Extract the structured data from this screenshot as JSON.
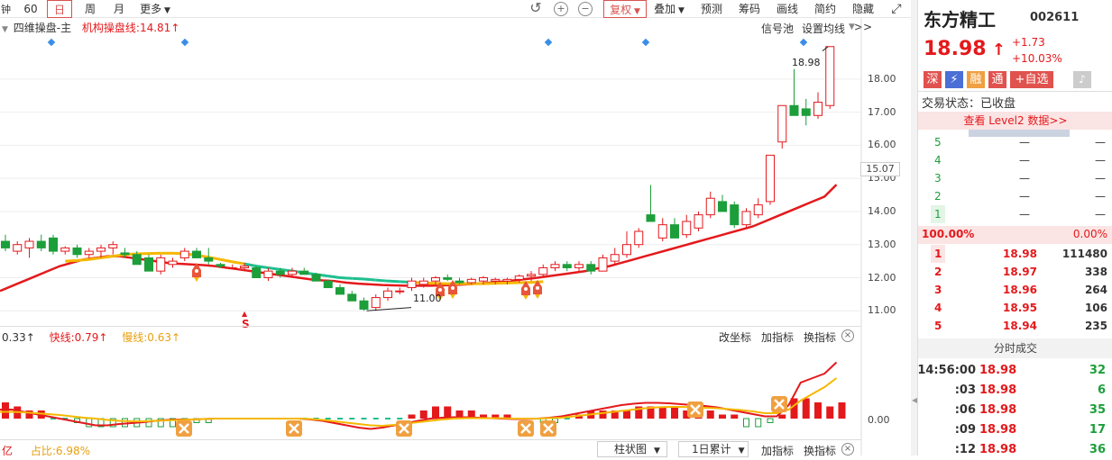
{
  "toolbar": {
    "periods": [
      "60",
      "日",
      "周",
      "月",
      "更多"
    ],
    "active_period": "日",
    "buttons": [
      "复权",
      "叠加",
      "预测",
      "筹码",
      "画线",
      "简约",
      "隐藏>>"
    ]
  },
  "main_indicator": {
    "name": "四维操盘-主",
    "line_label": "机构操盘线:14.81",
    "right_labels": [
      "信号池",
      "设置均线"
    ],
    "price_axis": [
      "18.00",
      "17.00",
      "16.00",
      "15.00",
      "14.00",
      "13.00",
      "12.00",
      "11.00"
    ],
    "current_marker": "15.07",
    "high_label": "18.98",
    "low_label": "11.00",
    "signal_letter": "S"
  },
  "sub_indicator": {
    "value_prefix": "0.33",
    "fast_label": "快线:0.79",
    "slow_label": "慢线:0.63",
    "right_buttons": [
      "改坐标",
      "加指标",
      "换指标"
    ],
    "zero_label": "0.00"
  },
  "bottom_bar": {
    "left_prefix": "亿",
    "ratio_label": "占比:6.98%",
    "chart_type": "柱状图",
    "accumulate": "1日累计",
    "buttons": [
      "加指标",
      "换指标"
    ]
  },
  "stock": {
    "name": "东方精工",
    "code": "002611",
    "price": "18.98",
    "change": "+1.73",
    "change_pct": "+10.03%",
    "tags": [
      "深",
      "融",
      "通",
      "+自选"
    ],
    "status_label": "交易状态：",
    "status_value": "已收盘",
    "level2_link": "查看 Level2 数据>>"
  },
  "order_book": {
    "sell": [
      {
        "level": "5",
        "price": "—",
        "vol": "—"
      },
      {
        "level": "4",
        "price": "—",
        "vol": "—"
      },
      {
        "level": "3",
        "price": "—",
        "vol": "—"
      },
      {
        "level": "2",
        "price": "—",
        "vol": "—"
      },
      {
        "level": "1",
        "price": "—",
        "vol": "—"
      }
    ],
    "ratio_left": "100.00%",
    "ratio_right": "0.00%",
    "buy": [
      {
        "level": "1",
        "price": "18.98",
        "vol": "111480"
      },
      {
        "level": "2",
        "price": "18.97",
        "vol": "338"
      },
      {
        "level": "3",
        "price": "18.96",
        "vol": "264"
      },
      {
        "level": "4",
        "price": "18.95",
        "vol": "106"
      },
      {
        "level": "5",
        "price": "18.94",
        "vol": "235"
      }
    ]
  },
  "trades": {
    "title": "分时成交",
    "rows": [
      {
        "time": "14:56:00",
        "price": "18.98",
        "vol": "32"
      },
      {
        "time": ":03",
        "price": "18.98",
        "vol": "6"
      },
      {
        "time": ":06",
        "price": "18.98",
        "vol": "35"
      },
      {
        "time": ":09",
        "price": "18.98",
        "vol": "17"
      },
      {
        "time": ":12",
        "price": "18.98",
        "vol": "36"
      }
    ]
  },
  "chart_data": {
    "type": "candlestick",
    "ylim": [
      10.6,
      19.3
    ],
    "candles": [
      {
        "o": 13.1,
        "h": 13.3,
        "l": 12.8,
        "c": 12.9
      },
      {
        "o": 12.8,
        "h": 13.1,
        "l": 12.7,
        "c": 13.0
      },
      {
        "o": 12.9,
        "h": 13.2,
        "l": 12.6,
        "c": 13.1
      },
      {
        "o": 13.1,
        "h": 13.3,
        "l": 12.8,
        "c": 12.9
      },
      {
        "o": 13.2,
        "h": 13.3,
        "l": 12.7,
        "c": 12.8
      },
      {
        "o": 12.8,
        "h": 12.95,
        "l": 12.7,
        "c": 12.9
      },
      {
        "o": 12.9,
        "h": 13.0,
        "l": 12.6,
        "c": 12.7
      },
      {
        "o": 12.7,
        "h": 12.9,
        "l": 12.6,
        "c": 12.8
      },
      {
        "o": 12.8,
        "h": 13.0,
        "l": 12.6,
        "c": 12.9
      },
      {
        "o": 12.9,
        "h": 13.1,
        "l": 12.7,
        "c": 13.0
      },
      {
        "o": 12.75,
        "h": 12.9,
        "l": 12.6,
        "c": 12.7
      },
      {
        "o": 12.7,
        "h": 12.8,
        "l": 12.4,
        "c": 12.4
      },
      {
        "o": 12.6,
        "h": 12.7,
        "l": 12.2,
        "c": 12.2
      },
      {
        "o": 12.2,
        "h": 12.7,
        "l": 12.1,
        "c": 12.6
      },
      {
        "o": 12.4,
        "h": 12.6,
        "l": 12.3,
        "c": 12.5
      },
      {
        "o": 12.6,
        "h": 12.9,
        "l": 12.5,
        "c": 12.8
      },
      {
        "o": 12.8,
        "h": 12.9,
        "l": 12.6,
        "c": 12.6
      },
      {
        "o": 12.6,
        "h": 12.9,
        "l": 12.4,
        "c": 12.5
      },
      {
        "o": 12.4,
        "h": 12.45,
        "l": 12.3,
        "c": 12.35
      },
      {
        "o": 12.3,
        "h": 12.4,
        "l": 12.3,
        "c": 12.3
      },
      {
        "o": 12.3,
        "h": 12.45,
        "l": 12.25,
        "c": 12.35
      },
      {
        "o": 12.3,
        "h": 12.35,
        "l": 12.0,
        "c": 12.0
      },
      {
        "o": 12.0,
        "h": 12.3,
        "l": 11.9,
        "c": 12.2
      },
      {
        "o": 12.2,
        "h": 12.3,
        "l": 12.0,
        "c": 12.1
      },
      {
        "o": 12.1,
        "h": 12.3,
        "l": 12.0,
        "c": 12.2
      },
      {
        "o": 12.2,
        "h": 12.3,
        "l": 12.1,
        "c": 12.1
      },
      {
        "o": 12.1,
        "h": 12.15,
        "l": 11.9,
        "c": 11.9
      },
      {
        "o": 11.9,
        "h": 11.95,
        "l": 11.7,
        "c": 11.7
      },
      {
        "o": 11.7,
        "h": 11.8,
        "l": 11.5,
        "c": 11.5
      },
      {
        "o": 11.5,
        "h": 11.6,
        "l": 11.3,
        "c": 11.3
      },
      {
        "o": 11.3,
        "h": 11.4,
        "l": 11.0,
        "c": 11.05
      },
      {
        "o": 11.1,
        "h": 11.5,
        "l": 11.0,
        "c": 11.4
      },
      {
        "o": 11.4,
        "h": 11.7,
        "l": 11.3,
        "c": 11.6
      },
      {
        "o": 11.6,
        "h": 11.7,
        "l": 11.5,
        "c": 11.6
      },
      {
        "o": 11.7,
        "h": 12.0,
        "l": 11.6,
        "c": 11.9
      },
      {
        "o": 11.8,
        "h": 12.0,
        "l": 11.7,
        "c": 11.9
      },
      {
        "o": 11.9,
        "h": 12.05,
        "l": 11.8,
        "c": 12.0
      },
      {
        "o": 12.0,
        "h": 12.1,
        "l": 11.9,
        "c": 11.95
      },
      {
        "o": 11.9,
        "h": 12.0,
        "l": 11.8,
        "c": 11.85
      },
      {
        "o": 11.85,
        "h": 12.0,
        "l": 11.8,
        "c": 11.95
      },
      {
        "o": 11.9,
        "h": 12.05,
        "l": 11.8,
        "c": 12.0
      },
      {
        "o": 11.9,
        "h": 12.0,
        "l": 11.8,
        "c": 11.95
      },
      {
        "o": 11.9,
        "h": 12.0,
        "l": 11.8,
        "c": 11.95
      },
      {
        "o": 11.95,
        "h": 12.1,
        "l": 11.85,
        "c": 12.05
      },
      {
        "o": 12.05,
        "h": 12.2,
        "l": 11.9,
        "c": 12.1
      },
      {
        "o": 12.1,
        "h": 12.4,
        "l": 12.0,
        "c": 12.3
      },
      {
        "o": 12.3,
        "h": 12.5,
        "l": 12.2,
        "c": 12.4
      },
      {
        "o": 12.4,
        "h": 12.5,
        "l": 12.2,
        "c": 12.3
      },
      {
        "o": 12.3,
        "h": 12.5,
        "l": 12.2,
        "c": 12.4
      },
      {
        "o": 12.4,
        "h": 12.5,
        "l": 12.1,
        "c": 12.2
      },
      {
        "o": 12.2,
        "h": 12.7,
        "l": 12.2,
        "c": 12.6
      },
      {
        "o": 12.5,
        "h": 12.9,
        "l": 12.4,
        "c": 12.7
      },
      {
        "o": 12.7,
        "h": 13.4,
        "l": 12.6,
        "c": 13.0
      },
      {
        "o": 13.0,
        "h": 13.5,
        "l": 12.9,
        "c": 13.4
      },
      {
        "o": 13.9,
        "h": 14.8,
        "l": 13.7,
        "c": 13.7
      },
      {
        "o": 13.2,
        "h": 13.8,
        "l": 13.1,
        "c": 13.6
      },
      {
        "o": 13.6,
        "h": 13.8,
        "l": 13.2,
        "c": 13.2
      },
      {
        "o": 13.3,
        "h": 13.9,
        "l": 13.2,
        "c": 13.7
      },
      {
        "o": 13.5,
        "h": 14.0,
        "l": 13.4,
        "c": 13.9
      },
      {
        "o": 13.9,
        "h": 14.6,
        "l": 13.8,
        "c": 14.4
      },
      {
        "o": 14.3,
        "h": 14.5,
        "l": 14.0,
        "c": 14.0
      },
      {
        "o": 14.2,
        "h": 14.3,
        "l": 13.5,
        "c": 13.6
      },
      {
        "o": 13.6,
        "h": 14.1,
        "l": 13.5,
        "c": 14.0
      },
      {
        "o": 13.9,
        "h": 14.4,
        "l": 13.8,
        "c": 14.2
      },
      {
        "o": 14.3,
        "h": 15.7,
        "l": 14.2,
        "c": 15.7
      },
      {
        "o": 16.1,
        "h": 17.2,
        "l": 15.9,
        "c": 17.2
      },
      {
        "o": 17.2,
        "h": 18.3,
        "l": 16.9,
        "c": 16.9
      },
      {
        "o": 17.1,
        "h": 17.4,
        "l": 16.6,
        "c": 16.9
      },
      {
        "o": 16.9,
        "h": 17.6,
        "l": 16.8,
        "c": 17.3
      },
      {
        "o": 17.2,
        "h": 18.98,
        "l": 17.1,
        "c": 18.98
      }
    ],
    "ma_line_red": [
      11.6,
      11.75,
      11.9,
      12.05,
      12.2,
      12.35,
      12.45,
      12.55,
      12.6,
      12.65,
      12.65,
      12.6,
      12.55,
      12.5,
      12.45,
      12.42,
      12.4,
      12.38,
      12.35,
      12.3,
      12.25,
      12.2,
      12.15,
      12.1,
      12.05,
      12.0,
      11.95,
      11.92,
      11.9,
      11.85,
      11.82,
      11.8,
      11.78,
      11.77,
      11.76,
      11.76,
      11.76,
      11.77,
      11.78,
      11.8,
      11.82,
      11.85,
      11.88,
      11.92,
      11.96,
      12.0,
      12.05,
      12.1,
      12.15,
      12.2,
      12.28,
      12.35,
      12.45,
      12.55,
      12.65,
      12.75,
      12.85,
      12.95,
      13.05,
      13.15,
      13.25,
      13.35,
      13.45,
      13.55,
      13.7,
      13.85,
      14.0,
      14.15,
      14.3,
      14.45,
      14.81
    ],
    "ma_line_trend": [
      12.5,
      12.52,
      12.55,
      12.6,
      12.65,
      12.7,
      12.72,
      12.73,
      12.74,
      12.74,
      12.72,
      12.68,
      12.62,
      12.55,
      12.48,
      12.42,
      12.35,
      12.3,
      12.25,
      12.2,
      12.15,
      12.1,
      12.05,
      12.0,
      11.98,
      11.96,
      11.93,
      11.9,
      11.88,
      11.86,
      11.84,
      11.83,
      11.82,
      11.82,
      11.82,
      11.82,
      11.83,
      11.84,
      11.85,
      11.86,
      11.88
    ]
  }
}
